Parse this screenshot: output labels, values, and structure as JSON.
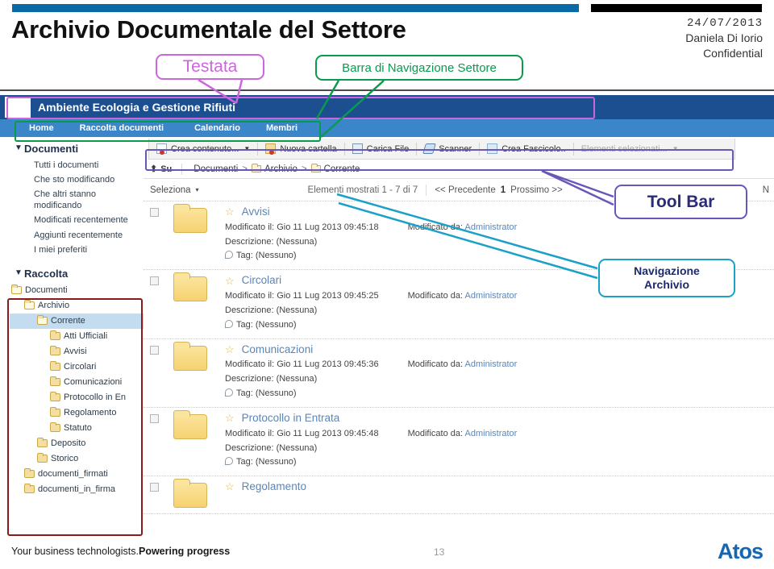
{
  "slide": {
    "title": "Archivio Documentale del Settore",
    "date": "24/07/2013",
    "author": "Daniela Di Iorio",
    "confidentiality": "Confidential",
    "page_number": "13",
    "footer_tagline_light": "Your business technologists.",
    "footer_tagline_bold": "Powering progress",
    "logo_text": "Atos",
    "accent_blue": "#0a6aa8",
    "accent_black": "#000000"
  },
  "callouts": {
    "testata": "Testata",
    "barra_navigazione": "Barra di Navigazione Settore",
    "tool_bar": "Tool Bar",
    "navigazione_archivio_line1": "Navigazione",
    "navigazione_archivio_line2": "Archivio",
    "color_testata": "#cc66dd",
    "color_barra": "#0a9a4e",
    "color_toolbar": "#6a56b8",
    "color_archivio": "#1ba0c8",
    "color_tree": "#8b1a1a"
  },
  "app": {
    "site_name": "Ambiente Ecologia e Gestione Rifiuti",
    "nav": [
      {
        "label": "Home"
      },
      {
        "label": "Raccolta documenti"
      },
      {
        "label": "Calendario"
      },
      {
        "label": "Membri"
      }
    ],
    "sidebar": {
      "documenti_title": "Documenti",
      "caret": "▼",
      "documenti_links": [
        "Tutti i documenti",
        "Che sto modificando",
        "Che altri stanno modificando",
        "Modificati recentemente",
        "Aggiunti recentemente",
        "I miei preferiti"
      ],
      "raccolta_title": "Raccolta",
      "tree": [
        {
          "label": "Documenti",
          "indent": 0,
          "selected": false,
          "open": true
        },
        {
          "label": "Archivio",
          "indent": 1,
          "selected": false,
          "open": true
        },
        {
          "label": "Corrente",
          "indent": 2,
          "selected": true,
          "open": true
        },
        {
          "label": "Atti Ufficiali",
          "indent": 3,
          "selected": false,
          "open": false
        },
        {
          "label": "Avvisi",
          "indent": 3,
          "selected": false,
          "open": false
        },
        {
          "label": "Circolari",
          "indent": 3,
          "selected": false,
          "open": false
        },
        {
          "label": "Comunicazioni",
          "indent": 3,
          "selected": false,
          "open": false
        },
        {
          "label": "Protocollo in En",
          "indent": 3,
          "selected": false,
          "open": false
        },
        {
          "label": "Regolamento",
          "indent": 3,
          "selected": false,
          "open": false
        },
        {
          "label": "Statuto",
          "indent": 3,
          "selected": false,
          "open": false
        },
        {
          "label": "Deposito",
          "indent": 2,
          "selected": false,
          "open": false
        },
        {
          "label": "Storico",
          "indent": 2,
          "selected": false,
          "open": false
        },
        {
          "label": "documenti_firmati",
          "indent": 1,
          "selected": false,
          "open": false
        },
        {
          "label": "documenti_in_firma",
          "indent": 1,
          "selected": false,
          "open": false
        }
      ]
    },
    "toolbar": {
      "buttons": [
        {
          "label": "Crea contenuto...",
          "icon": "new-document-icon",
          "dropdown": true,
          "disabled": false
        },
        {
          "label": "Nuova cartella",
          "icon": "new-folder-icon",
          "dropdown": false,
          "disabled": false
        },
        {
          "label": "Carica File",
          "icon": "upload-icon",
          "dropdown": false,
          "disabled": false
        },
        {
          "label": "Scanner",
          "icon": "scanner-icon",
          "dropdown": false,
          "disabled": false
        },
        {
          "label": "Crea Fascicolo..",
          "icon": "folder-case-icon",
          "dropdown": false,
          "disabled": false
        },
        {
          "label": "Elementi selezionati...",
          "icon": "none",
          "dropdown": true,
          "disabled": true
        }
      ]
    },
    "breadcrumb": {
      "up_label": "Su",
      "up_icon": "arrow-up-icon",
      "items": [
        {
          "label": "Documenti",
          "folder": false
        },
        {
          "label": "Archivio",
          "folder": true
        },
        {
          "label": "Corrente",
          "folder": true
        }
      ],
      "separator": ">"
    },
    "listbar": {
      "select_label": "Seleziona",
      "select_caret": "▾",
      "shown_label": "Elementi mostrati 1 - 7 di 7",
      "prev_label": "<< Precedente",
      "page_number": "1",
      "next_label": "Prossimo >>",
      "right_column_label": "N"
    },
    "list": {
      "labels": {
        "modified_on": "Modificato il:",
        "modified_by": "Modificato da:",
        "description": "Descrizione:",
        "tag": "Tag:"
      },
      "items": [
        {
          "name": "Avvisi",
          "modified_on": "Gio 11 Lug 2013 09:45:18",
          "modified_by": "Administrator",
          "description": "(Nessuna)",
          "tag": "(Nessuno)",
          "truncated": false
        },
        {
          "name": "Circolari",
          "modified_on": "Gio 11 Lug 2013 09:45:25",
          "modified_by": "Administrator",
          "description": "(Nessuna)",
          "tag": "(Nessuno)",
          "truncated": false
        },
        {
          "name": "Comunicazioni",
          "modified_on": "Gio 11 Lug 2013 09:45:36",
          "modified_by": "Administrator",
          "description": "(Nessuna)",
          "tag": "(Nessuno)",
          "truncated": false
        },
        {
          "name": "Protocollo in Entrata",
          "modified_on": "Gio 11 Lug 2013 09:45:48",
          "modified_by": "Administrator",
          "description": "(Nessuna)",
          "tag": "(Nessuno)",
          "truncated": false
        },
        {
          "name": "Regolamento",
          "modified_on": "",
          "modified_by": "",
          "description": "",
          "tag": "",
          "truncated": true
        }
      ]
    }
  }
}
